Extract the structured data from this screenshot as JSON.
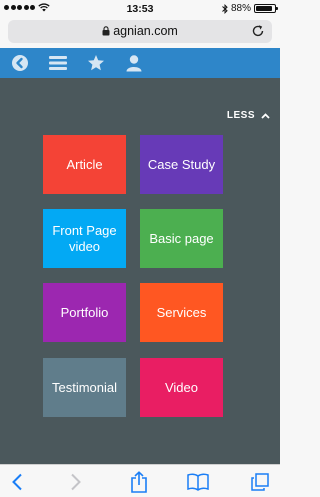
{
  "status": {
    "time": "13:53",
    "battery": "88%",
    "battery_level": 0.88
  },
  "browser": {
    "url": "agnian.com"
  },
  "nav": {
    "icons": [
      "back-circle-icon",
      "menu-icon",
      "star-icon",
      "user-icon"
    ]
  },
  "panel": {
    "less_label": "LESS"
  },
  "tiles": [
    {
      "label": "Article",
      "color": "#f44336"
    },
    {
      "label": "Case Study",
      "color": "#673ab7"
    },
    {
      "label": "Front Page video",
      "color": "#03a9f4"
    },
    {
      "label": "Basic page",
      "color": "#4caf50"
    },
    {
      "label": "Portfolio",
      "color": "#9c27b0"
    },
    {
      "label": "Services",
      "color": "#ff5722"
    },
    {
      "label": "Testimonial",
      "color": "#607d8b"
    },
    {
      "label": "Video",
      "color": "#e91e63"
    }
  ],
  "colors": {
    "nav_bg": "#2e86c9",
    "panel_bg": "#4b585c",
    "ios_blue": "#1a7ef6"
  }
}
